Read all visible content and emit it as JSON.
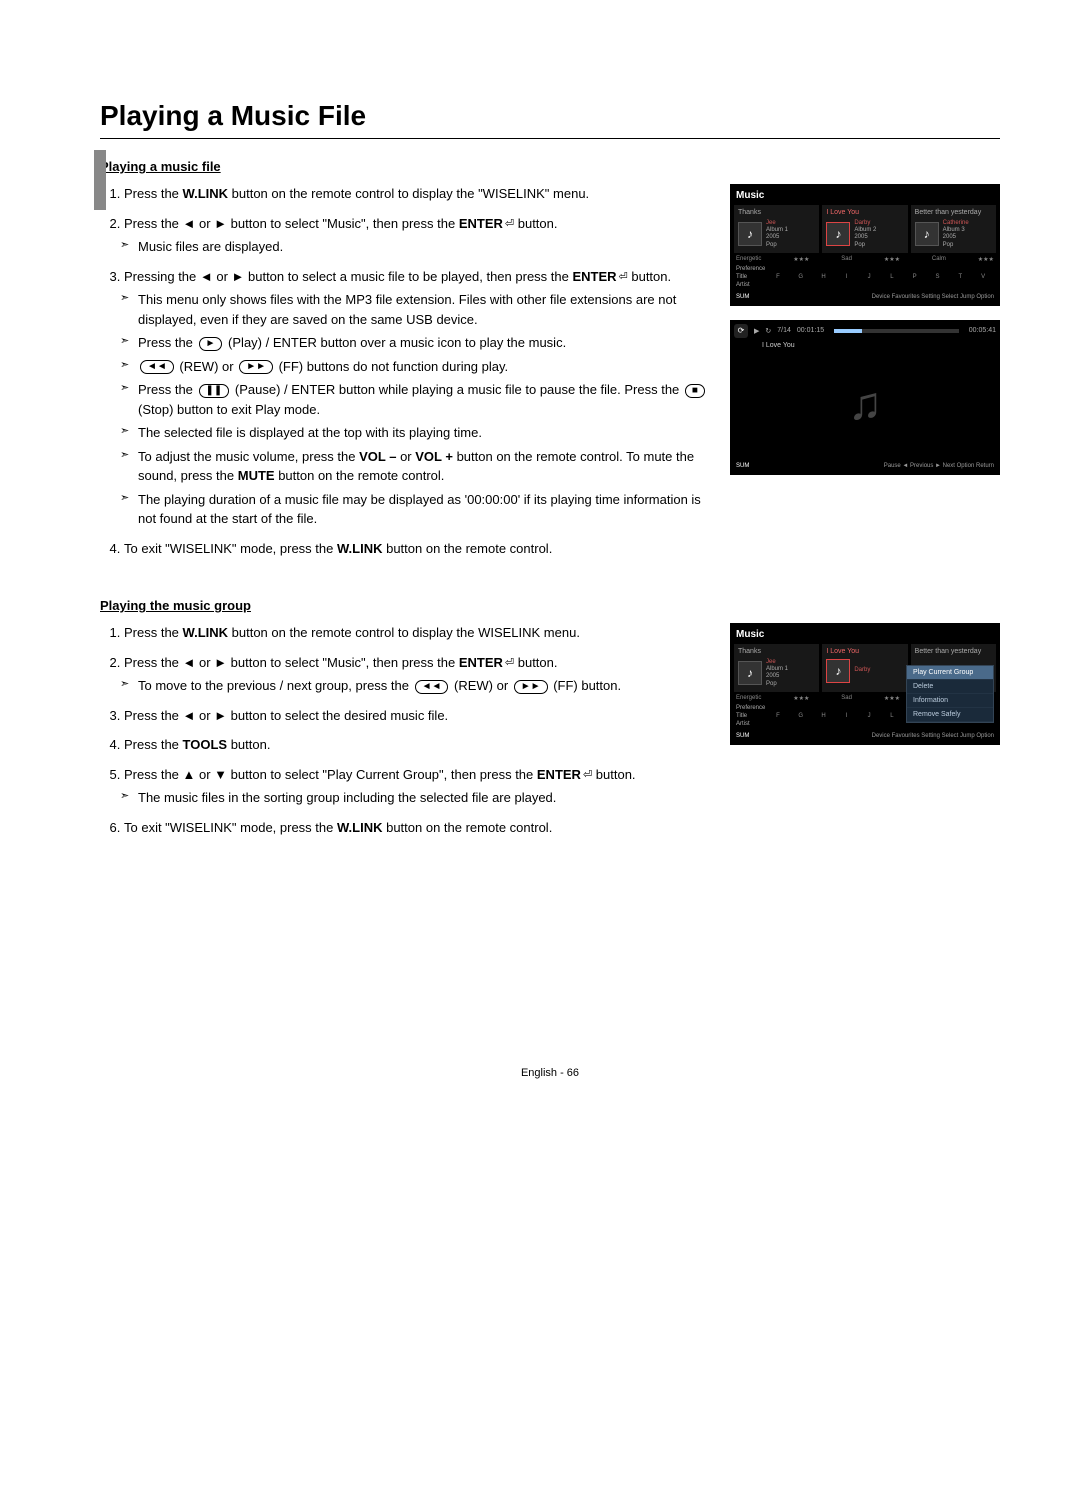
{
  "page": {
    "title": "Playing a Music File",
    "footer": "English - 66"
  },
  "section1": {
    "heading": "Playing a music file",
    "step1": "Press the W.LINK button on the remote control to display the \"WISELINK\" menu.",
    "step2": "Press the ◄ or ► button to select \"Music\", then press the ENTER button.",
    "step2_note1": "Music files are displayed.",
    "step3": "Pressing the ◄ or ► button to select a music file to be played, then press the ENTER button.",
    "step3_note1": "This menu only shows files with the MP3 file extension. Files with other file extensions are not displayed, even if they are saved on the same USB device.",
    "step3_note2_a": "Press the ",
    "step3_note2_b": " (Play) / ENTER button over a music icon to play the music.",
    "step3_note3_a": " (REW) or ",
    "step3_note3_b": " (FF) buttons do not function during play.",
    "step3_note4_a": "Press the ",
    "step3_note4_b": " (Pause) / ENTER button while playing a music file to pause the file. Press the ",
    "step3_note4_c": " (Stop) button to exit Play mode.",
    "step3_note5": "The selected file is displayed at the top with its playing time.",
    "step3_note6": "To adjust the music volume, press the VOL – or VOL + button on the remote control. To mute the sound, press the MUTE button on the remote control.",
    "step3_note7": "The playing duration of a music file may be displayed as '00:00:00' if its playing time information is not found at the start of the file.",
    "step4": "To exit \"WISELINK\" mode, press the W.LINK button on the remote control."
  },
  "section2": {
    "heading": "Playing the music group",
    "step1": "Press the W.LINK button on the remote control to display the WISELINK menu.",
    "step2": "Press the ◄ or ► button to select \"Music\", then press the ENTER button.",
    "step2_note1_a": "To move to the previous / next group, press the ",
    "step2_note1_b": " (REW) or ",
    "step2_note1_c": " (FF) button.",
    "step3": "Press the ◄ or ► button to select the desired music file.",
    "step4": "Press the TOOLS button.",
    "step5": "Press the ▲ or ▼ button to select \"Play Current Group\", then press the ENTER button.",
    "step5_note1": "The music files in the sorting group including the selected file are played.",
    "step6": "To exit \"WISELINK\" mode, press the W.LINK button on the remote control."
  },
  "icons": {
    "play": "►",
    "rew": "◄◄",
    "ff": "►►",
    "pause": "❚❚",
    "stop": "■",
    "enter": "⏎"
  },
  "fig1": {
    "title": "Music",
    "cols": [
      "Thanks",
      "I Love You",
      "Better than yesterday"
    ],
    "tracks": [
      {
        "name": "Jee",
        "album": "Album 1",
        "year": "2005",
        "genre": "Pop"
      },
      {
        "name": "Darby",
        "album": "Album 2",
        "year": "2005",
        "genre": "Pop"
      },
      {
        "name": "Catherine",
        "album": "Album 3",
        "year": "2005",
        "genre": "Pop"
      }
    ],
    "moods": [
      "Energetic",
      "Sad",
      "Calm"
    ],
    "tabs": [
      "Preference",
      "Title",
      "Artist"
    ],
    "alpha": [
      "F",
      "G",
      "H",
      "I",
      "J",
      "L",
      "P",
      "S",
      "T",
      "V"
    ],
    "sum": "SUM",
    "bottom": "Device   Favourites Setting   Select   Jump   Option"
  },
  "fig2": {
    "track_num": "7/14",
    "elapsed": "00:01:15",
    "total": "00:05:41",
    "song": "I Love You",
    "sum": "SUM",
    "bottom": "Pause   ◄ Previous   ► Next   Option   Return"
  },
  "fig3": {
    "title": "Music",
    "menu": [
      "Play Current Group",
      "Delete",
      "Information",
      "Remove Safely"
    ],
    "sum": "SUM",
    "bottom": "Device   Favourites Setting   Select   Jump   Option"
  }
}
